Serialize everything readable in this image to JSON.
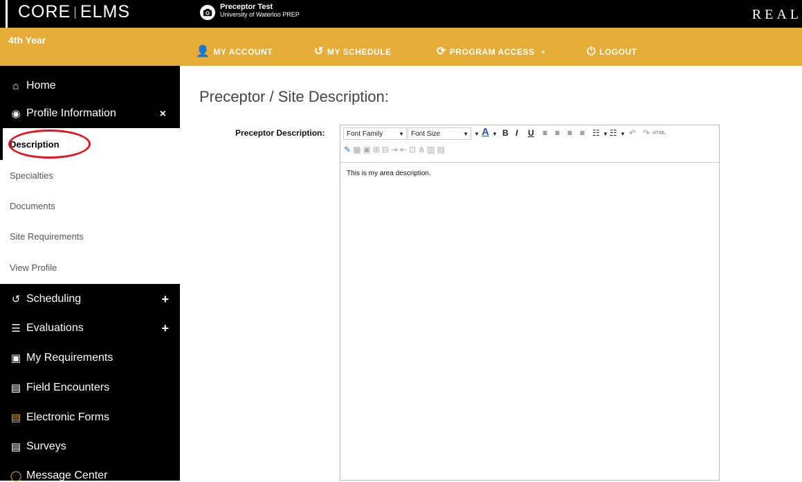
{
  "header": {
    "logo": {
      "left": "CORE",
      "separator": "|",
      "right": "ELMS"
    },
    "user_name": "Preceptor Test",
    "user_org": "University of Waterloo PREP",
    "brand_right": "REAL"
  },
  "nav": {
    "year": "4th Year",
    "links": [
      {
        "label": "MY ACCOUNT",
        "icon": "user-edit-icon"
      },
      {
        "label": "MY SCHEDULE",
        "icon": "history-icon"
      },
      {
        "label": "PROGRAM ACCESS",
        "icon": "sync-icon",
        "suffix": "+"
      },
      {
        "label": "LOGOUT",
        "icon": "power-icon"
      }
    ]
  },
  "sidebar": {
    "home": "Home",
    "profile": "Profile Information",
    "profile_toggle": "×",
    "sub_items": [
      "Description",
      "Specialties",
      "Documents",
      "Site Requirements",
      "View Profile"
    ],
    "scheduling": "Scheduling",
    "evaluations": "Evaluations",
    "plus": "+",
    "my_requirements": "My Requirements",
    "field_encounters": "Field Encounters",
    "electronic_forms": "Electronic Forms",
    "surveys": "Surveys",
    "message_center": "Message Center"
  },
  "main": {
    "title": "Preceptor / Site Description:",
    "field_label": "Preceptor Description:",
    "editor": {
      "font_family": "Font Family",
      "font_size": "Font Size",
      "html_label": "HTML",
      "content": "This is my area description."
    }
  },
  "colors": {
    "accent": "#e5ac37",
    "annotation": "#e3141f"
  }
}
